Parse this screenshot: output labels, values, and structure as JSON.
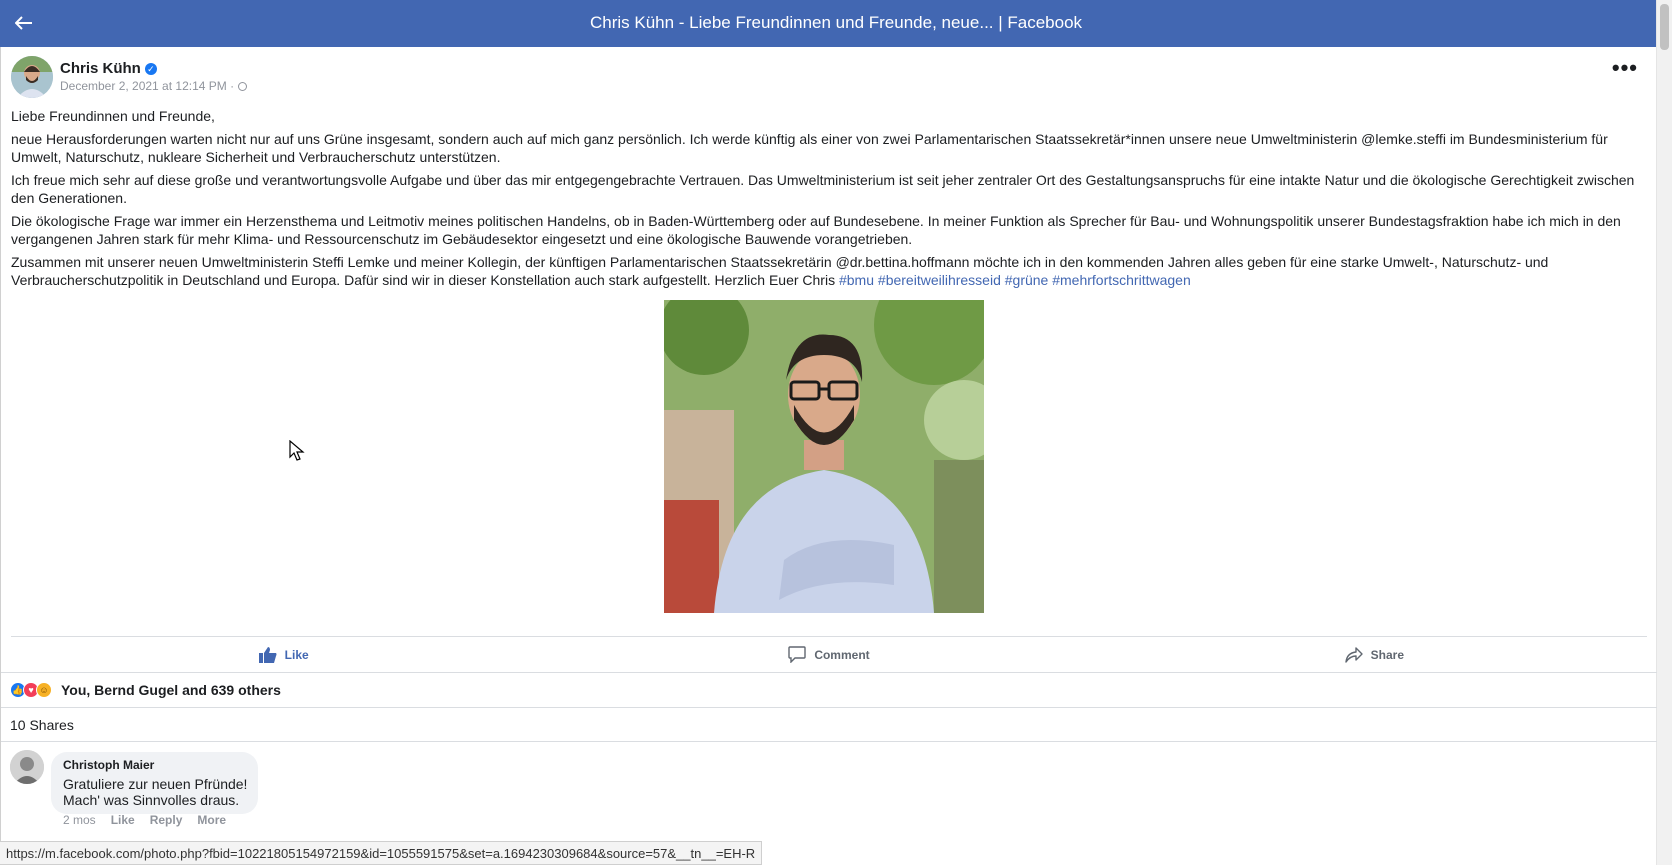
{
  "header": {
    "title": "Chris Kühn - Liebe Freundinnen und Freunde, neue... | Facebook"
  },
  "post": {
    "author": "Chris Kühn",
    "verified_icon": "verified-badge-icon",
    "timestamp": "December 2, 2021 at 12:14 PM ·",
    "paragraphs": [
      "Liebe Freundinnen und Freunde,",
      "neue Herausforderungen warten nicht nur auf uns Grüne insgesamt, sondern auch auf mich ganz persönlich. Ich werde künftig als einer von zwei Parlamentarischen Staatssekretär*innen unsere neue Umweltministerin @lemke.steffi im Bundesministerium für Umwelt, Naturschutz, nukleare Sicherheit und Verbraucherschutz unterstützen.",
      "Ich freue mich sehr auf diese große und verantwortungsvolle Aufgabe und über das mir entgegengebrachte Vertrauen. Das Umweltministerium ist seit jeher zentraler Ort des Gestaltungsanspruchs für eine intakte Natur und die ökologische Gerechtigkeit zwischen den Generationen.",
      "Die ökologische Frage war immer ein Herzensthema und Leitmotiv meines politischen Handelns, ob in Baden-Württemberg oder auf Bundesebene. In meiner Funktion als Sprecher für Bau- und Wohnungspolitik unserer Bundestagsfraktion habe ich mich in den vergangenen Jahren stark für mehr Klima- und Ressourcenschutz im Gebäudesektor eingesetzt und eine ökologische Bauwende vorangetrieben."
    ],
    "last_paragraph": "Zusammen mit unserer neuen Umweltministerin Steffi Lemke und meiner Kollegin, der künftigen Parlamentarischen Staatssekretärin @dr.bettina.hoffmann möchte ich in den kommenden Jahren alles geben für eine starke Umwelt-, Naturschutz- und Verbraucherschutzpolitik in Deutschland und Europa. Dafür sind wir in dieser Konstellation auch stark aufgestellt. Herzlich Euer Chris",
    "hashtags": [
      "#bmu",
      "#bereitweilihresseid",
      "#grüne",
      "#mehrfortschrittwagen"
    ]
  },
  "actions": {
    "like": "Like",
    "comment": "Comment",
    "share": "Share"
  },
  "reactions": {
    "summary": "You, Bernd Gugel and 639 others"
  },
  "shares": {
    "label": "10 Shares"
  },
  "comment": {
    "author": "Christoph Maier",
    "body": "Gratuliere zur neuen Pfründe!\nMach' was Sinnvolles draus.",
    "age": "2 mos",
    "like": "Like",
    "reply": "Reply",
    "more": "More"
  },
  "status_url": "https://m.facebook.com/photo.php?fbid=10221805154972159&id=1055591575&set=a.1694230309684&source=57&__tn__=EH-R",
  "colors": {
    "header_bg": "#4267b2",
    "link": "#4267b2",
    "muted": "#90949c"
  }
}
